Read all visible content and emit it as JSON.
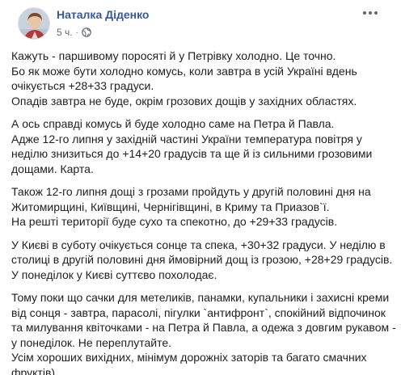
{
  "post": {
    "author": "Наталка Діденко",
    "time": "5 ч.",
    "separator": "·",
    "privacy_icon": "globe-icon",
    "more_icon": "more-options-icon",
    "paragraphs": [
      [
        "Кажуть - паршивому поросяті й у Петрівку холодно. Це точно.",
        "Бо як може бути холодно комусь, коли завтра в усій Україні вдень",
        "очікується +28+33 градуси.",
        "Опадів завтра не буде, окрім грозових дощів у західних областях."
      ],
      [
        "А ось справді комусь й буде холодно саме на Петра й Павла.",
        "Адже 12-го липня у західній частині України температура повітря у",
        "неділю знизиться до +14+20 градусів та ще й із сильними грозовими",
        "дощами. Карта."
      ],
      [
        "Також 12-го липня дощі з грозами пройдуть у другій половині дня на",
        "Житомирщині, Київщині, Чернігівщині, в Криму та Приазов`ї.",
        "На решті території буде сухо та спекотно, до +29+33 градусів."
      ],
      [
        "У Києві в суботу очікується сонце та спека, +30+32 градуси. У неділю в",
        "столиці в другій половині дня ймовірний дощ із грозою, +28+29 градусів.",
        "У понеділок у Києві суттєво похолодає."
      ],
      [
        "Тому поки що сачки для метеликів, панамки, купальники і захисні креми",
        "від сонця - завтра, парасолі, пігулки `антифронт`, спокійний відпочинок",
        "та милування квіточками - на Петра й Павла, а одежа з довгим рукавом -",
        "у понеділок. Не переплутайте.",
        "Усім хороших вихідних, мінімум дорожніх заторів та багато смачних",
        "фруктів)"
      ]
    ]
  },
  "colors": {
    "author": "#385898",
    "meta": "#616770",
    "text": "#1c1e21"
  }
}
